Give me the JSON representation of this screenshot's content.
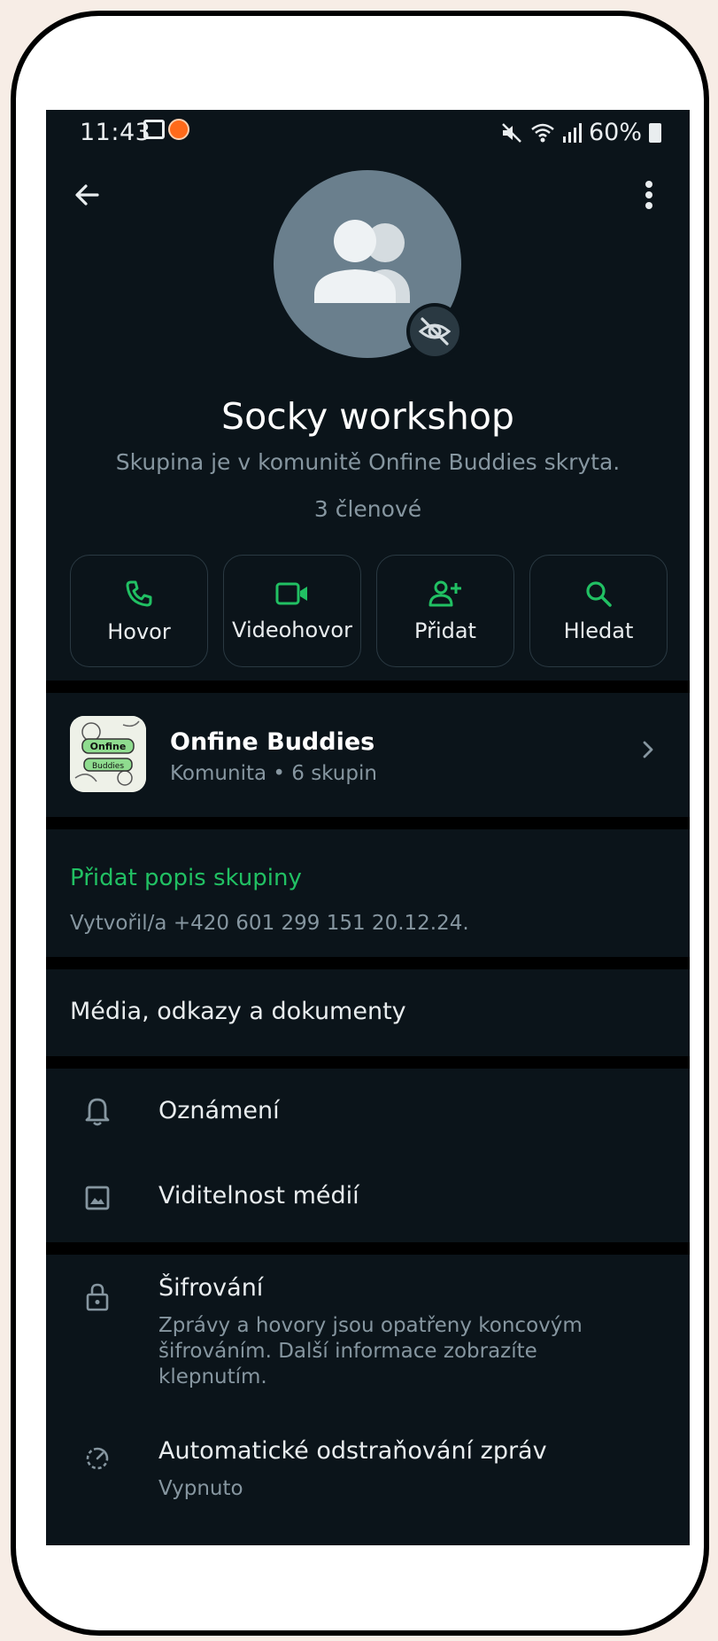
{
  "status_bar": {
    "time": "11:43",
    "battery": "60%",
    "icons": [
      "notification-square-icon",
      "orange-app-icon",
      "mute-icon",
      "wifi-icon",
      "signal-icon",
      "battery-icon"
    ]
  },
  "header": {
    "back_icon": "arrow-back-icon",
    "menu_icon": "more-vertical-icon"
  },
  "group": {
    "name": "Socky workshop",
    "subtitle": "Skupina je v komunitě Onfine Buddies skryta.",
    "members": "3 členové",
    "avatar_icon": "group-people-icon",
    "hidden_badge_icon": "eye-off-icon"
  },
  "actions": [
    {
      "label": "Hovor",
      "icon": "phone-icon"
    },
    {
      "label": "Videohovor",
      "icon": "video-icon"
    },
    {
      "label": "Přidat",
      "icon": "add-person-icon"
    },
    {
      "label": "Hledat",
      "icon": "search-icon"
    }
  ],
  "community": {
    "name": "Onfine Buddies",
    "subtitle": "Komunita • 6 skupin",
    "logo_text_top": "Onfine",
    "logo_text_bottom": "Buddies"
  },
  "description": {
    "add_label": "Přidat popis skupiny",
    "created": "Vytvořil/a +420 601 299 151 20.12.24."
  },
  "media": {
    "label": "Média, odkazy a dokumenty"
  },
  "settings": {
    "notifications": "Oznámení",
    "media_visibility": "Viditelnost médií",
    "encryption_title": "Šifrování",
    "encryption_desc": "Zprávy a hovory jsou opatřeny koncovým šifrováním. Další informace zobrazíte klepnutím.",
    "disappearing_title": "Automatické odstraňování zpráv",
    "disappearing_value": "Vypnuto"
  },
  "colors": {
    "background": "#0b141a",
    "accent": "#21c063",
    "secondary_text": "#8696a0",
    "avatar": "#6a7f8d"
  }
}
